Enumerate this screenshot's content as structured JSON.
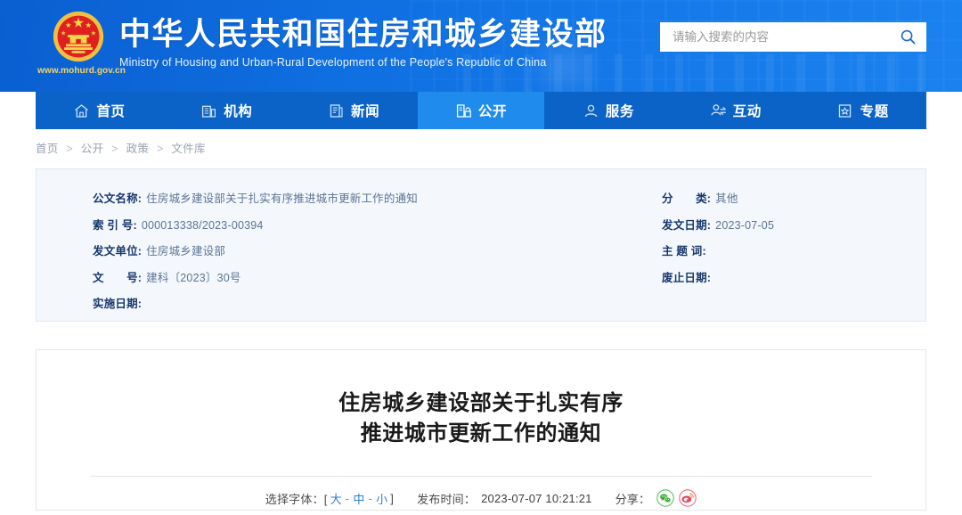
{
  "header": {
    "emblem_icon": "china-national-emblem",
    "site_url": "www.mohurd.gov.cn",
    "title_cn": "中华人民共和国住房和城乡建设部",
    "title_en": "Ministry of Housing and Urban-Rural Development of the People's Republic of China",
    "search": {
      "placeholder": "请输入搜索的内容",
      "value": "",
      "icon": "search-icon"
    }
  },
  "nav": {
    "active_index": 3,
    "items": [
      {
        "label": "首页",
        "icon": "home-icon"
      },
      {
        "label": "机构",
        "icon": "building-icon"
      },
      {
        "label": "新闻",
        "icon": "news-document-icon"
      },
      {
        "label": "公开",
        "icon": "open-disclosure-icon"
      },
      {
        "label": "服务",
        "icon": "user-service-icon"
      },
      {
        "label": "互动",
        "icon": "interaction-exchange-icon"
      },
      {
        "label": "专题",
        "icon": "star-topic-icon"
      }
    ]
  },
  "breadcrumb": {
    "items": [
      "首页",
      "公开",
      "政策",
      "文件库"
    ],
    "separator": ">"
  },
  "meta": {
    "left": [
      {
        "label": "公文名称:",
        "value": "住房城乡建设部关于扎实有序推进城市更新工作的通知"
      },
      {
        "label": "索 引 号:",
        "value": "000013338/2023-00394"
      },
      {
        "label": "发文单位:",
        "value": "住房城乡建设部"
      },
      {
        "label": "文　　号:",
        "value": "建科〔2023〕30号"
      },
      {
        "label": "实施日期:",
        "value": ""
      }
    ],
    "right": [
      {
        "label": "分　　类:",
        "value": "其他"
      },
      {
        "label": "发文日期:",
        "value": "2023-07-05"
      },
      {
        "label": "主 题 词:",
        "value": ""
      },
      {
        "label": "废止日期:",
        "value": ""
      }
    ]
  },
  "document": {
    "title_line1": "住房城乡建设部关于扎实有序",
    "title_line2": "推进城市更新工作的通知",
    "toolbar": {
      "fontsize_label": "选择字体：[",
      "fontsize_close": "]",
      "fontsize_options": [
        "大",
        "中",
        "小"
      ],
      "fontsize_dash": "-",
      "publish_label": "发布时间：",
      "publish_time": "2023-07-07 10:21:21",
      "share_label": "分享：",
      "share_items": [
        {
          "name": "wechat-share-icon",
          "color": "#3cb034"
        },
        {
          "name": "weibo-share-icon",
          "color": "#e6415c"
        }
      ]
    }
  },
  "colors": {
    "brand_blue": "#0f6ee0",
    "nav_blue": "#0b63c8",
    "nav_active_blue": "#1f8ced",
    "meta_panel_bg": "#f4f8fd",
    "meta_label": "#17386e",
    "meta_value": "#5d7396",
    "link_blue": "#2b7fd4",
    "emblem_gold": "#f4d66a",
    "emblem_red": "#e02020"
  }
}
